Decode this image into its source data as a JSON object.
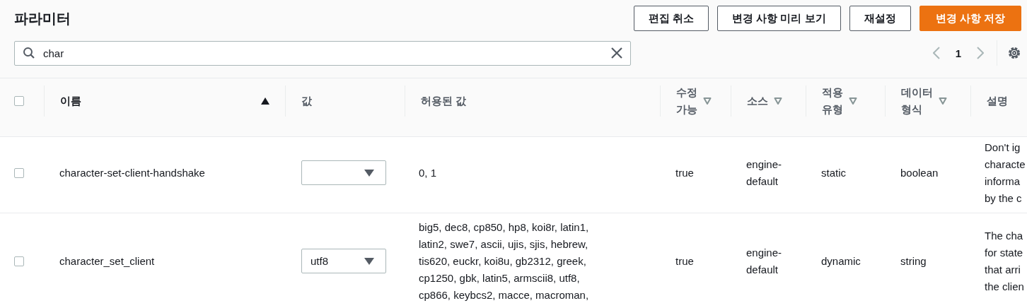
{
  "title": "파라미터",
  "buttons": [
    {
      "label": "편집 취소",
      "kind": "normal"
    },
    {
      "label": "변경 사항 미리 보기",
      "kind": "normal"
    },
    {
      "label": "재설정",
      "kind": "normal"
    },
    {
      "label": "변경 사항 저장",
      "kind": "primary"
    }
  ],
  "search": {
    "value": "char"
  },
  "pagination": {
    "page": "1"
  },
  "table": {
    "select_all": {
      "checked": false
    },
    "columns": [
      {
        "label": "이름",
        "kind": "sorted"
      },
      {
        "label": "값",
        "kind": "plain"
      },
      {
        "label": "허용된 값",
        "kind": "plain"
      },
      {
        "label": "수정\n가능",
        "kind": "sortable"
      },
      {
        "label": "소스",
        "kind": "sortable"
      },
      {
        "label": "적용\n유형",
        "kind": "sortable"
      },
      {
        "label": "데이터\n형식",
        "kind": "sortable"
      },
      {
        "label": "설명",
        "kind": "plain"
      }
    ],
    "rows": [
      {
        "checked": false,
        "name": "character-set-client-handshake",
        "allowed_values": [
          "0, 1"
        ],
        "editable": "true",
        "source": "engine-\ndefault",
        "apply_type": "static",
        "data_type": "boolean",
        "description": [
          "Don't ig",
          "characte",
          "informa",
          "by the c"
        ]
      },
      {
        "checked": false,
        "name": "character_set_client",
        "value": "utf8",
        "allowed_values": [
          "big5, dec8, cp850, hp8, koi8r, latin1,",
          "latin2, swe7, ascii, ujis, sjis, hebrew,",
          "tis620, euckr, koi8u, gb2312, greek,",
          "cp1250, gbk, latin5, armscii8, utf8,",
          "cp866, keybcs2, macce, macroman,"
        ],
        "editable": "true",
        "source": "engine-\ndefault",
        "apply_type": "dynamic",
        "data_type": "string",
        "description": [
          "The cha",
          "for state",
          "that arri",
          "the clien"
        ]
      }
    ]
  }
}
